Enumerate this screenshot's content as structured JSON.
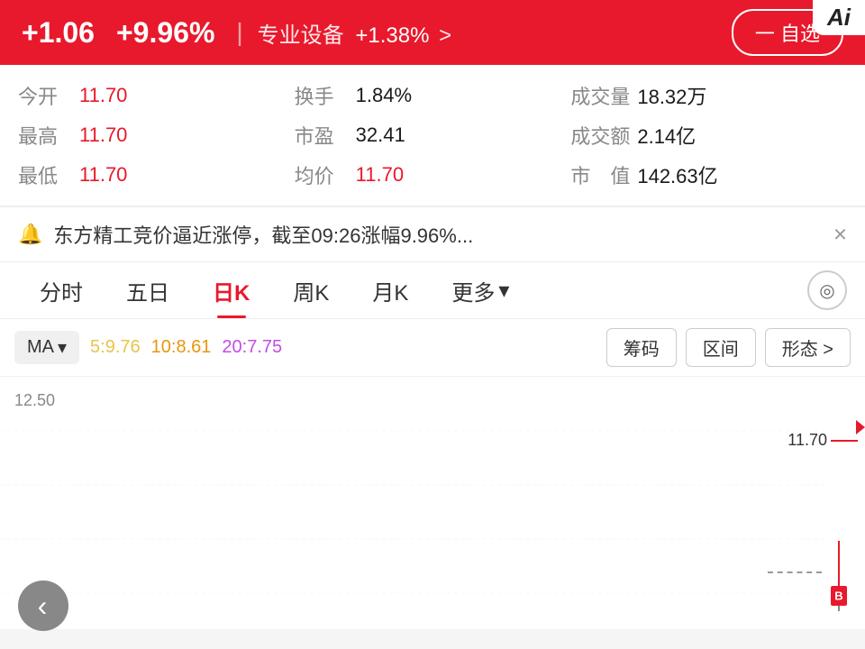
{
  "header": {
    "price_change": "+1.06",
    "pct_change": "+9.96%",
    "divider": "|",
    "sector_name": "专业设备",
    "sector_change": "+1.38%",
    "sector_chevron": ">",
    "watchlist_btn": "一 自选"
  },
  "stats": {
    "rows": [
      [
        {
          "label": "今开",
          "value": "11.70",
          "color": "red"
        },
        {
          "label": "换手",
          "value": "1.84%",
          "color": "black"
        },
        {
          "label": "成交量",
          "value": "18.32万",
          "color": "black"
        }
      ],
      [
        {
          "label": "最高",
          "value": "11.70",
          "color": "red"
        },
        {
          "label": "市盈",
          "value": "32.41",
          "color": "black"
        },
        {
          "label": "成交额",
          "value": "2.14亿",
          "color": "black"
        }
      ],
      [
        {
          "label": "最低",
          "value": "11.70",
          "color": "red"
        },
        {
          "label": "均价",
          "value": "11.70",
          "color": "red"
        },
        {
          "label": "市  值",
          "value": "142.63亿",
          "color": "black"
        }
      ]
    ]
  },
  "alert": {
    "text": "东方精工竞价逼近涨停，截至09:26涨幅9.96%...",
    "close": "×"
  },
  "tabs": {
    "items": [
      {
        "label": "分时",
        "active": false
      },
      {
        "label": "五日",
        "active": false
      },
      {
        "label": "日K",
        "active": true
      },
      {
        "label": "周K",
        "active": false
      },
      {
        "label": "月K",
        "active": false
      },
      {
        "label": "更多",
        "active": false,
        "has_arrow": true
      }
    ]
  },
  "chart_toolbar": {
    "ma_label": "MA",
    "ma_dropdown": "▾",
    "ma5": "5:9.76",
    "ma10": "10:8.61",
    "ma20": "20:7.75",
    "btn_chips": "筹码",
    "btn_range": "区间",
    "btn_shape": "形态 >"
  },
  "chart": {
    "y_label_top": "12.50",
    "price_current": "11.70",
    "price_line_label": "11.70 —"
  },
  "back_btn": "‹",
  "ai_btn": "Ai"
}
